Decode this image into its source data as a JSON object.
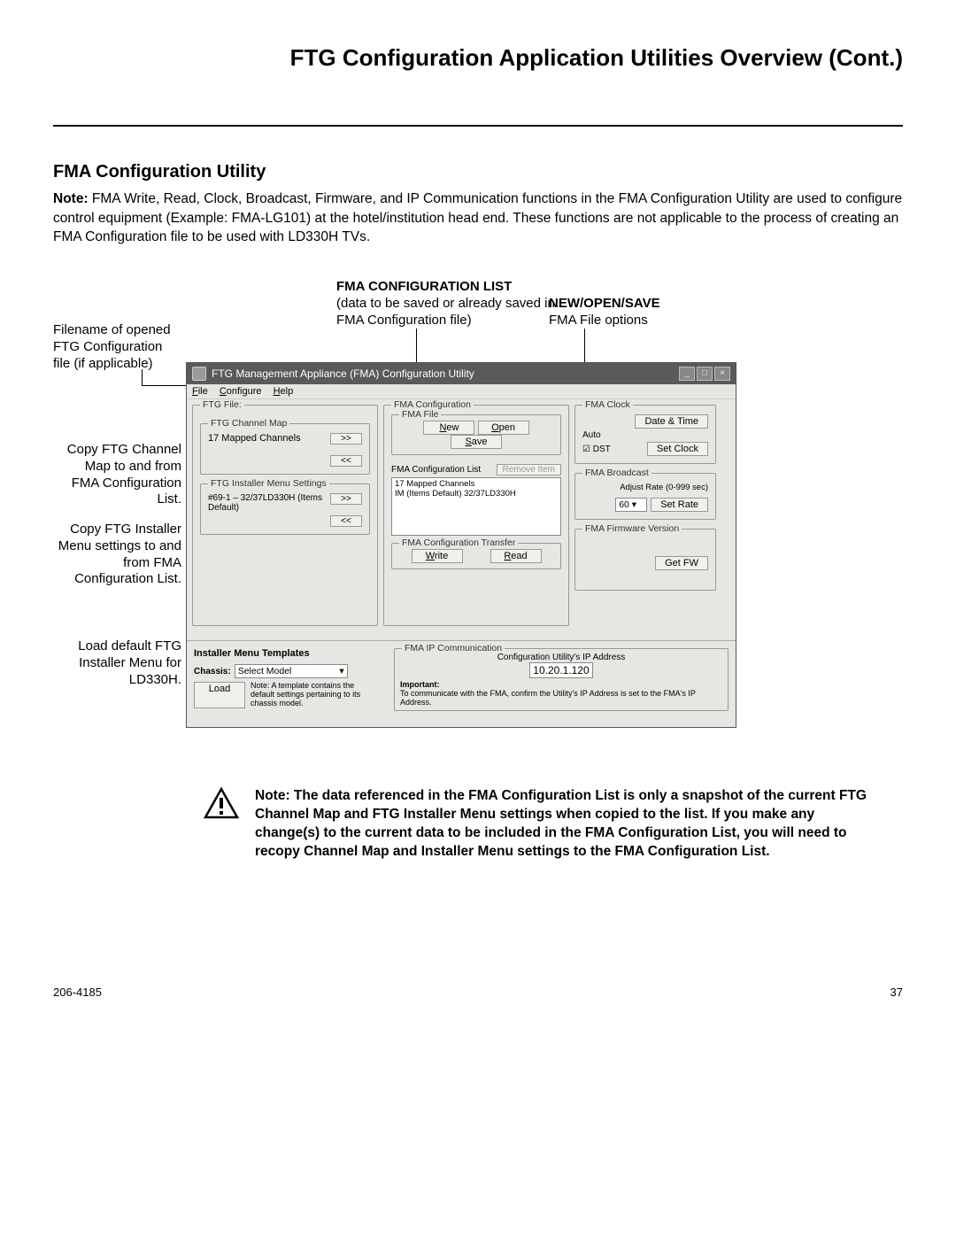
{
  "page": {
    "title": "FTG Configuration Application Utilities Overview (Cont.)",
    "section_title": "FMA Configuration Utility",
    "note_bold": "Note:",
    "note_body": " FMA Write, Read, Clock, Broadcast, Firmware, and IP Communication functions in the FMA Configuration Utility are used to configure control equipment (Example: FMA-LG101) at the hotel/institution head end. These functions are not applicable to the process of creating an FMA Configuration file to be used with LD330H TVs.",
    "footer_left": "206-4185",
    "footer_right": "37"
  },
  "callouts": {
    "filename": "Filename of opened FTG Configuration file (if applicable)",
    "fma_list_head": "FMA CONFIGURATION LIST",
    "fma_list_sub": "(data to be saved or already saved in FMA Configuration file)",
    "new_open_save_head": "NEW/OPEN/SAVE",
    "new_open_save_sub": "FMA File options",
    "copy_channel": "Copy FTG Channel Map to and from FMA Configuration List.",
    "copy_installer": "Copy FTG Installer Menu settings to and from FMA Configuration List.",
    "load_default": "Load default FTG Installer Menu for LD330H."
  },
  "window": {
    "title": "FTG Management Appliance (FMA) Configuration Utility",
    "menu_file": "File",
    "menu_configure": "Configure",
    "menu_help": "Help",
    "ftg_file_group": "FTG File:",
    "channel_map_group": "FTG Channel Map",
    "channel_map_text": "17 Mapped Channels",
    "btn_copy_right": ">>",
    "btn_copy_left": "<<",
    "installer_group": "FTG Installer Menu Settings",
    "installer_text": "#69-1 – 32/37LD330H (Items Default)",
    "fma_config_group": "FMA Configuration",
    "fma_file_group": "FMA File",
    "btn_new": "New",
    "btn_open": "Open",
    "btn_save": "Save",
    "fma_list_group": "FMA Configuration List",
    "btn_remove": "Remove Item",
    "fma_list_line1": "17 Mapped Channels",
    "fma_list_line2": "IM (Items Default) 32/37LD330H",
    "transfer_group": "FMA Configuration Transfer",
    "btn_write": "Write",
    "btn_read": "Read",
    "clock_group": "FMA Clock",
    "clock_btn_dt": "Date & Time",
    "clock_auto": "Auto",
    "clock_dst": "DST",
    "clock_btn_set": "Set Clock",
    "broadcast_group": "FMA Broadcast",
    "broadcast_label": "Adjust Rate (0-999 sec)",
    "broadcast_value": "60",
    "btn_set_rate": "Set Rate",
    "fw_group": "FMA Firmware Version",
    "btn_get_fw": "Get FW",
    "templates_head": "Installer Menu Templates",
    "chassis_label": "Chassis:",
    "chassis_value": "Select Model",
    "btn_load": "Load",
    "template_note": "Note: A template contains the default settings pertaining to its chassis model.",
    "ip_group": "FMA IP Communication",
    "ip_label": "Configuration Utility's IP Address",
    "ip_value": "10.20.1.120",
    "important_head": "Important:",
    "important_body": "To communicate with the FMA, confirm the Utility's IP Address is set to the FMA's IP Address."
  },
  "warning": {
    "text": "Note: The data referenced in the FMA Configuration List is only a snapshot of the current FTG Channel Map and FTG Installer Menu settings when copied to the list. If you make any change(s) to the current data to be included in the FMA Configuration List, you will need to recopy Channel Map and Installer Menu settings to the FMA Configuration List."
  }
}
